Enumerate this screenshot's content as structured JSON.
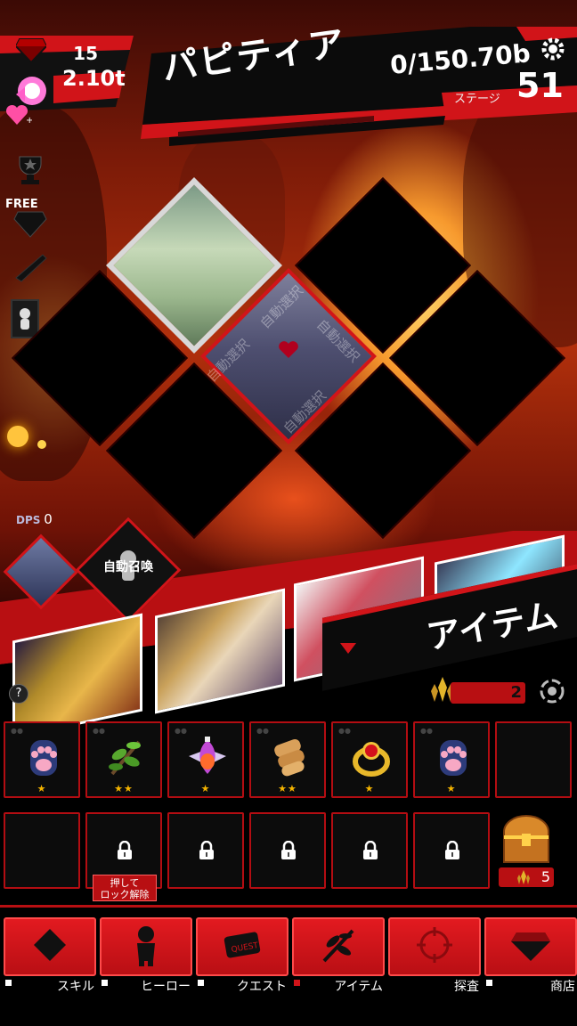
{
  "header": {
    "gem_count": "15",
    "gold_count": "2.10t",
    "hero_name": "パピティア",
    "hp": "0/150.70b",
    "stage_label": "ステージ",
    "stage_number": "51"
  },
  "side": {
    "free_label": "FREE",
    "dps_label": "DPS",
    "dps_value": "0"
  },
  "field": {
    "auto_select_text": "自動選択"
  },
  "hero_strip": {
    "auto_summon_label": "自動召喚",
    "help_label": "?",
    "section_title": "アイテム"
  },
  "currency": {
    "crystal_count": "2"
  },
  "items": {
    "row1": [
      {
        "name": "paw",
        "stars": "★"
      },
      {
        "name": "branch",
        "stars": "★★"
      },
      {
        "name": "potion",
        "stars": "★"
      },
      {
        "name": "scroll",
        "stars": "★★"
      },
      {
        "name": "ring",
        "stars": "★"
      },
      {
        "name": "paw",
        "stars": "★"
      },
      {
        "name": "empty",
        "stars": ""
      }
    ],
    "unlock_tip": "押して\nロック解除",
    "chest_count": "5"
  },
  "nav": {
    "items": [
      {
        "label": "スキル",
        "icon": "diamond-icon"
      },
      {
        "label": "ヒーロー",
        "icon": "hero-silhouette-icon"
      },
      {
        "label": "クエスト",
        "icon": "quest-scroll-icon"
      },
      {
        "label": "アイテム",
        "icon": "item-leaf-icon"
      },
      {
        "label": "探査",
        "icon": "explore-target-icon"
      },
      {
        "label": "商店",
        "icon": "gem-shop-icon"
      }
    ]
  },
  "colors": {
    "accent_red": "#d11419",
    "star_gold": "#f4b400"
  }
}
